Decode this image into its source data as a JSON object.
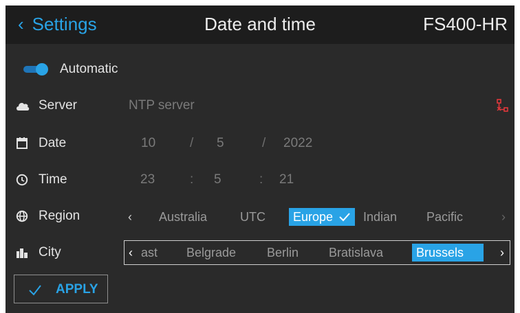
{
  "header": {
    "back_label": "Settings",
    "title": "Date and time",
    "model": "FS400-HR"
  },
  "automatic": {
    "label": "Automatic",
    "enabled": true
  },
  "server": {
    "label": "Server",
    "placeholder": "NTP server",
    "icon": "cloud-icon",
    "status_icon": "network-error-icon",
    "status_color": "#e0383b"
  },
  "date": {
    "label": "Date",
    "icon": "calendar-icon",
    "day": "10",
    "month": "5",
    "year": "2022",
    "sep1": "/",
    "sep2": "/"
  },
  "time": {
    "label": "Time",
    "icon": "clock-icon",
    "hour": "23",
    "minute": "5",
    "second": "21",
    "sep1": ":",
    "sep2": ":"
  },
  "region": {
    "label": "Region",
    "icon": "globe-icon",
    "options": [
      "Australia",
      "UTC",
      "Europe",
      "Indian",
      "Pacific"
    ],
    "selected": "Europe",
    "prev_arrow": "‹",
    "next_arrow": "›"
  },
  "city": {
    "label": "City",
    "icon": "city-icon",
    "options": [
      "ast",
      "Belgrade",
      "Berlin",
      "Bratislava",
      "Brussels"
    ],
    "selected": "Brussels",
    "prev_arrow": "‹",
    "next_arrow": "›"
  },
  "apply": {
    "label": "APPLY"
  },
  "colors": {
    "accent": "#29a3e6",
    "background": "#2a2a2a",
    "header": "#1d1d1d"
  }
}
